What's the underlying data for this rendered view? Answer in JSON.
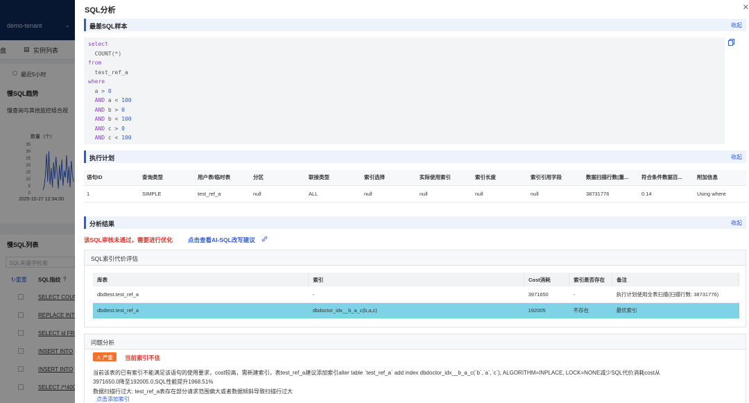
{
  "background": {
    "tenant": "demo-tenant",
    "tab_left": "盘",
    "tab_instances": "实例列表",
    "time_range": "最近5小时",
    "slow_trend_title": "慢SQL趋势",
    "slow_trend_sub": "慢查询与其他监控组合视",
    "y_axis_label": "数量（个）",
    "y_ticks": [
      "35",
      "30",
      "25",
      "20",
      "15",
      "10",
      "5",
      "0"
    ],
    "x_label": "2025-10-27 12:34:00",
    "slow_list_title": "慢SQL列表",
    "search_placeholder": "SQL关键字检索",
    "reset": "重置",
    "fingerprint_col": "SQL指纹",
    "rows": [
      "SELECT COUN",
      "REPLACE INTO",
      "SELECT id FRO",
      "INSERT INTO ",
      "INSERT INTO ",
      "SELECT /*!400"
    ]
  },
  "drawer": {
    "title": "SQL分析",
    "close_icon": "close-icon",
    "worst_sample": {
      "title": "最差SQL样本",
      "collapse": "收起",
      "code": [
        [
          {
            "t": "select",
            "c": "kw"
          }
        ],
        [
          {
            "t": "  COUNT(*)",
            "c": "pl"
          }
        ],
        [
          {
            "t": "from",
            "c": "kw"
          }
        ],
        [
          {
            "t": "  test_ref_a",
            "c": "pl"
          }
        ],
        [
          {
            "t": "where",
            "c": "kw"
          }
        ],
        [
          {
            "t": "  a > ",
            "c": "pl"
          },
          {
            "t": "0",
            "c": "num"
          }
        ],
        [
          {
            "t": "  AND ",
            "c": "kw"
          },
          {
            "t": "a < ",
            "c": "pl"
          },
          {
            "t": "100",
            "c": "num"
          }
        ],
        [
          {
            "t": "  AND ",
            "c": "kw"
          },
          {
            "t": "b > ",
            "c": "pl"
          },
          {
            "t": "0",
            "c": "num"
          }
        ],
        [
          {
            "t": "  AND ",
            "c": "kw"
          },
          {
            "t": "b < ",
            "c": "pl"
          },
          {
            "t": "100",
            "c": "num"
          }
        ],
        [
          {
            "t": "  AND ",
            "c": "kw"
          },
          {
            "t": "c > ",
            "c": "pl"
          },
          {
            "t": "0",
            "c": "num"
          }
        ],
        [
          {
            "t": "  AND ",
            "c": "kw"
          },
          {
            "t": "c < ",
            "c": "pl"
          },
          {
            "t": "100",
            "c": "num"
          }
        ]
      ]
    },
    "exec_plan": {
      "title": "执行计划",
      "collapse": "收起",
      "columns": [
        "语句ID",
        "查询类型",
        "用户表/临时表",
        "分区",
        "联接类型",
        "索引选择",
        "实际使用索引",
        "索引长度",
        "索引引用字段",
        "数据扫描行数(重...",
        "符合条件数据百...",
        "附加信息"
      ],
      "rows": [
        [
          "1",
          "SIMPLE",
          "test_ref_a",
          "null",
          "ALL",
          "null",
          "null",
          "null",
          "null",
          "38731776",
          "0.14",
          "Using where"
        ]
      ]
    },
    "analysis": {
      "title": "分析结果",
      "collapse": "收起",
      "warning": "该SQL审核未通过，需要进行优化",
      "ai_link": "点击查看AI-SQL改写建议"
    },
    "cost_eval": {
      "title": "SQL索引代价评估",
      "columns": [
        "库表",
        "索引",
        "Cost消耗",
        "索引是否存在",
        "备注"
      ],
      "rows": [
        [
          "dbdtest.test_ref_a",
          "-",
          "3971650",
          "-",
          "执行计划使用全表扫描(扫描行数: 38731776)"
        ],
        [
          "dbdtest.test_ref_a",
          "dbdoctor_idx__b_a_c(b,a,c)",
          "192005",
          "不存在",
          "最优索引"
        ]
      ]
    },
    "problem": {
      "title": "问题分析",
      "badge": "严重",
      "badge_title": "当前索引不佳",
      "line1": "当前该表的已有索引不能满足该语句的使用要求，cost较高，需新建索引，表test_ref_a建议添加索引alter table `test_ref_a` add index dbdoctor_idx__b_a_c(`b`,`a`,`c`), ALGORITHM=INPLACE, LOCK=NONE减少SQL代价消耗cost从",
      "line2": "3971650.0降至192005.0,SQL性能提升1968.51%",
      "line3": "数据扫描行过大: test_ref_a表存在部分请求范围偏大或者数据倾斜导致扫描行过大",
      "add_index": "点击添加索引"
    }
  },
  "colors": {
    "accent": "#2f5bd0",
    "danger": "#e0322c",
    "badge": "#f0722e",
    "highlight_row": "#7fd3e6"
  }
}
